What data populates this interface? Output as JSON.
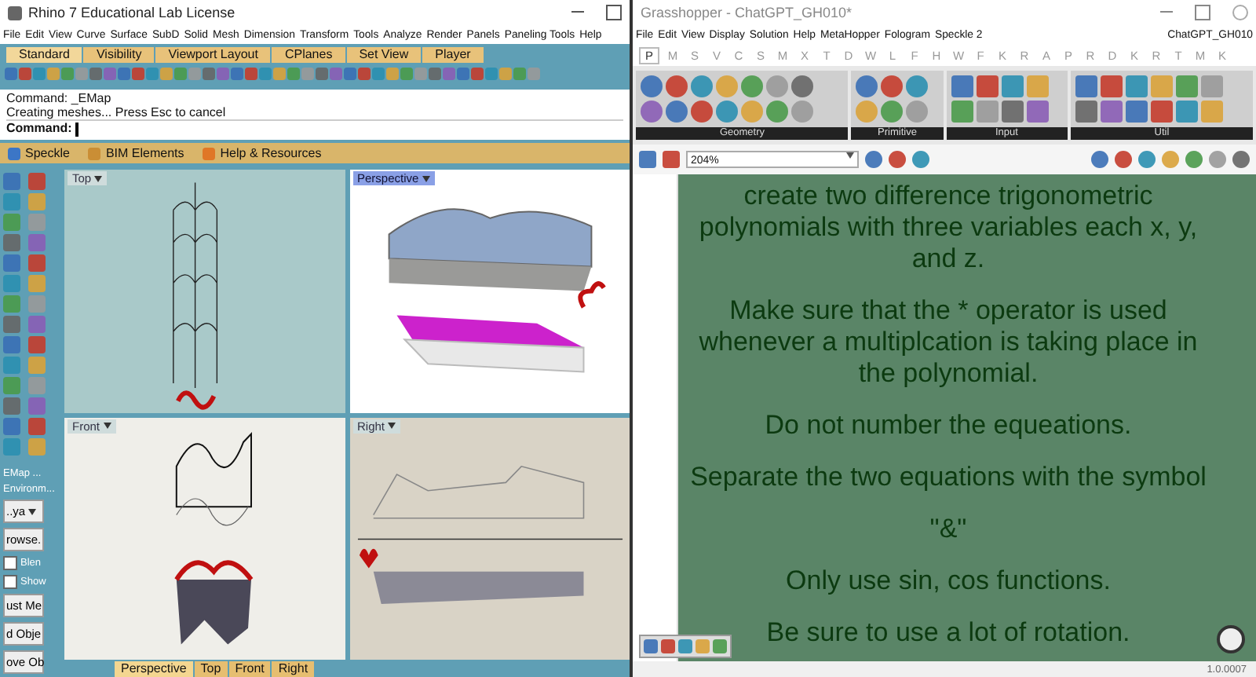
{
  "rhino": {
    "title": "Rhino 7 Educational Lab License",
    "menu": [
      "File",
      "Edit",
      "View",
      "Curve",
      "Surface",
      "SubD",
      "Solid",
      "Mesh",
      "Dimension",
      "Transform",
      "Tools",
      "Analyze",
      "Render",
      "Panels",
      "Paneling Tools",
      "Help"
    ],
    "toolbar_tabs": [
      {
        "label": "Standard",
        "selected": true
      },
      {
        "label": "Visibility",
        "selected": false
      },
      {
        "label": "Viewport Layout",
        "selected": false
      },
      {
        "label": "CPlanes",
        "selected": false
      },
      {
        "label": "Set View",
        "selected": false
      },
      {
        "label": "Player",
        "selected": false
      }
    ],
    "command_history": [
      "Command: _EMap",
      "Creating meshes... Press Esc to cancel"
    ],
    "command_prompt": "Command:",
    "plugin_bar": [
      "Speckle",
      "BIM Elements",
      "Help & Resources"
    ],
    "side_panel": {
      "title": "EMap ...",
      "section": "Environm...",
      "dropdown": "..ya",
      "browse_button": "rowse.",
      "checkboxes": [
        {
          "label": "Blen",
          "checked": false
        },
        {
          "label": "Show",
          "checked": false
        }
      ],
      "buttons": [
        "ust Me",
        "d Obje",
        "ove Ob"
      ]
    },
    "viewports": [
      {
        "label": "Top",
        "kind": "top",
        "active": false
      },
      {
        "label": "Perspective",
        "kind": "perspective",
        "active": true
      },
      {
        "label": "Front",
        "kind": "front",
        "active": false
      },
      {
        "label": "Right",
        "kind": "right",
        "active": false
      }
    ],
    "viewport_tabs": [
      {
        "label": "Perspective",
        "selected": true
      },
      {
        "label": "Top",
        "selected": false
      },
      {
        "label": "Front",
        "selected": false
      },
      {
        "label": "Right",
        "selected": false
      }
    ]
  },
  "grasshopper": {
    "title": "Grasshopper - ChatGPT_GH010*",
    "menu": [
      "File",
      "Edit",
      "View",
      "Display",
      "Solution",
      "Help",
      "MetaHopper",
      "Fologram",
      "Speckle 2"
    ],
    "document_name": "ChatGPT_GH010",
    "tabs": [
      {
        "label": "P",
        "selected": true
      },
      {
        "label": "M",
        "selected": false
      },
      {
        "label": "S",
        "selected": false
      },
      {
        "label": "V",
        "selected": false
      },
      {
        "label": "C",
        "selected": false
      },
      {
        "label": "S",
        "selected": false
      },
      {
        "label": "M",
        "selected": false
      },
      {
        "label": "X",
        "selected": false
      },
      {
        "label": "T",
        "selected": false
      },
      {
        "label": "D",
        "selected": false
      },
      {
        "label": "W",
        "selected": false
      },
      {
        "label": "L",
        "selected": false
      },
      {
        "label": "F",
        "selected": false
      },
      {
        "label": "H",
        "selected": false
      },
      {
        "label": "W",
        "selected": false
      },
      {
        "label": "F",
        "selected": false
      },
      {
        "label": "K",
        "selected": false
      },
      {
        "label": "R",
        "selected": false
      },
      {
        "label": "A",
        "selected": false
      },
      {
        "label": "P",
        "selected": false
      },
      {
        "label": "R",
        "selected": false
      },
      {
        "label": "D",
        "selected": false
      },
      {
        "label": "K",
        "selected": false
      },
      {
        "label": "R",
        "selected": false
      },
      {
        "label": "T",
        "selected": false
      },
      {
        "label": "M",
        "selected": false
      },
      {
        "label": "K",
        "selected": false
      }
    ],
    "palette_groups": [
      "Geometry",
      "Primitive",
      "Input",
      "Util"
    ],
    "zoom": "204%",
    "panel_paragraphs": [
      "create two difference trigonometric polynomials with three variables each x, y, and z.",
      "Make sure that the * operator is used whenever a multiplcation is taking place in the polynomial.",
      "Do not number the equeations.",
      "Separate the two equations with the symbol",
      "\"&\"",
      "Only use sin, cos functions.",
      "Be sure to use a lot of rotation."
    ],
    "version": "1.0.0007"
  }
}
